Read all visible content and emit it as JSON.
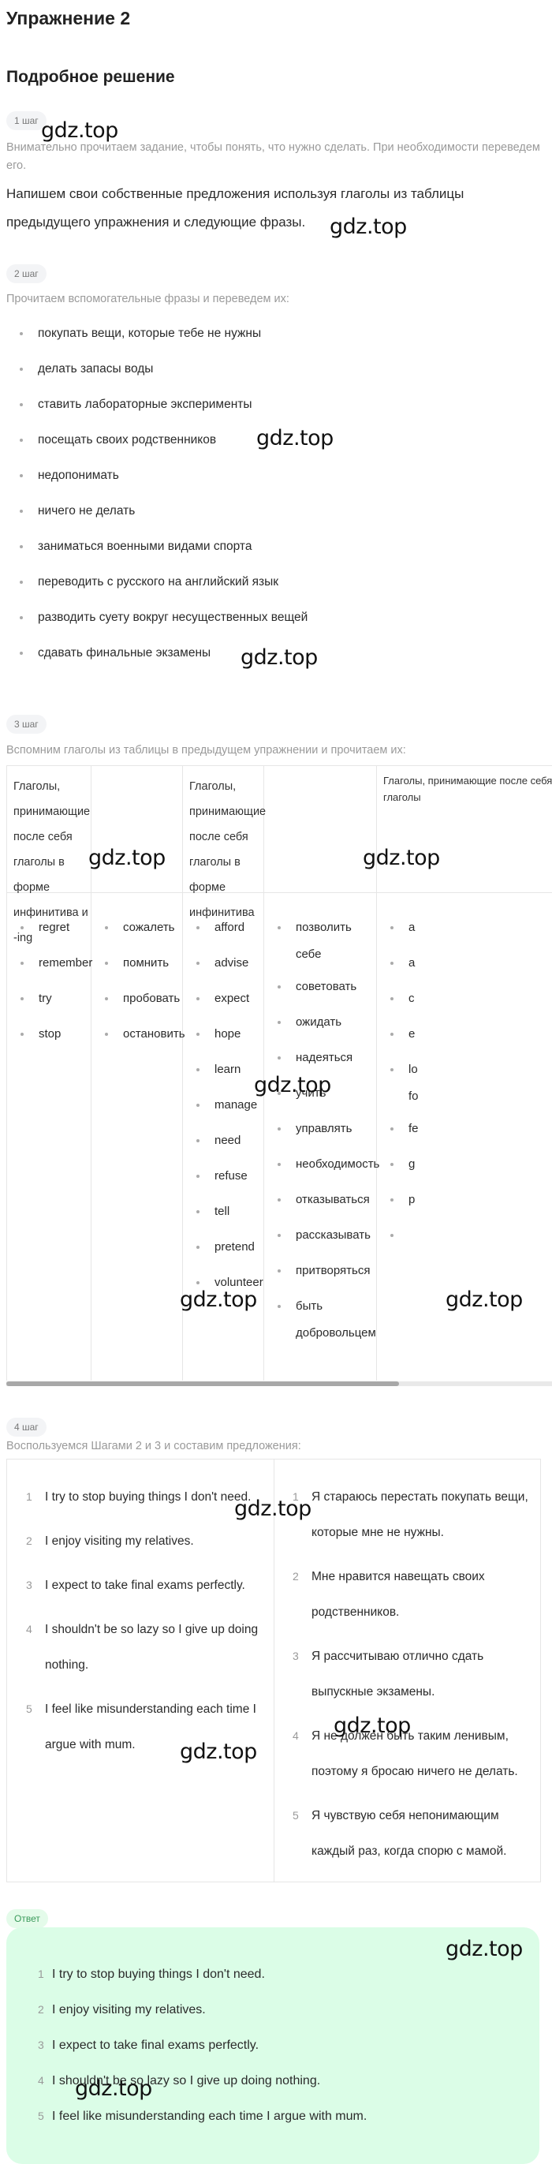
{
  "title": "Упражнение 2",
  "subtitle": "Подробное решение",
  "steps": [
    {
      "label": "1 шаг",
      "description": "Внимательно прочитаем задание, чтобы понять, что нужно сделать. При необходимости переведем его.",
      "text": "Напишем свои собственные предложения используя глаголы из таблицы предыдущего упражнения и следующие фразы."
    },
    {
      "label": "2 шаг",
      "description": "Прочитаем вспомогательные фразы и переведем их:",
      "items": [
        "покупать вещи, которые тебе не нужны",
        "делать запасы воды",
        "ставить лабораторные эксперименты",
        "посещать своих родственников",
        "недопонимать",
        "ничего не делать",
        "заниматься военными видами спорта",
        "переводить с русского на английский язык",
        "разводить суету вокруг несущественных вещей",
        "сдавать финальные экзамены"
      ]
    },
    {
      "label": "3 шаг",
      "description": "Вспомним глаголы из таблицы в предыдущем упражнении и прочитаем их:",
      "table": {
        "headers": [
          "Глаголы, принимающие после себя глаголы в форме инфинитива и -ing",
          "",
          "Глаголы, принимающие после себя глаголы в форме инфинитива",
          "",
          "Глаголы, принимающие после себя глаголы"
        ],
        "columns": [
          [
            "regret",
            "remember",
            "try",
            "stop"
          ],
          [
            "сожалеть",
            "помнить",
            "пробовать",
            "остановить"
          ],
          [
            "afford",
            "advise",
            "expect",
            "hope",
            "learn",
            "manage",
            "need",
            "refuse",
            "tell",
            "pretend",
            "volunteer"
          ],
          [
            "позволить себе",
            "советовать",
            "ожидать",
            "надеяться",
            "учить",
            "управлять",
            "необходимость",
            "отказываться",
            "рассказывать",
            "притворяться",
            "быть добровольцем"
          ],
          [
            "a",
            "a",
            "c",
            "e",
            "lo fo",
            "fe",
            "g",
            "p",
            ""
          ]
        ]
      }
    },
    {
      "label": "4 шаг",
      "description": "Воспользуемся Шагами 2 и 3 и составим предложения:",
      "english": [
        "I try to stop buying things I don't need.",
        "I enjoy visiting my relatives.",
        "I expect to take final exams perfectly.",
        "I shouldn't be so lazy so I give up doing nothing.",
        "I feel like misunderstanding each time I argue with mum."
      ],
      "russian": [
        "Я стараюсь перестать покупать вещи, которые мне не нужны.",
        "Мне нравится навещать своих родственников.",
        "Я рассчитываю отлично сдать выпускные экзамены.",
        "Я не должен быть таким ленивым, поэтому я бросаю ничего не делать.",
        "Я чувствую себя непонимающим каждый раз, когда спорю с мамой."
      ]
    }
  ],
  "answer": {
    "label": "Ответ",
    "items": [
      "I try to stop buying things I don't need.",
      "I enjoy visiting my relatives.",
      "I expect to take final exams perfectly.",
      "I shouldn't be so lazy so I give up doing nothing.",
      "I feel like misunderstanding each time I argue with mum."
    ]
  },
  "table_scroll_fraction": 0.72,
  "watermark": "gdz.top",
  "colors": {
    "answer_bg": "#dbfde7",
    "answer_label": "#3a9a5a",
    "pill_bg": "#f3f4f6",
    "muted_text": "#9a9a9a"
  }
}
